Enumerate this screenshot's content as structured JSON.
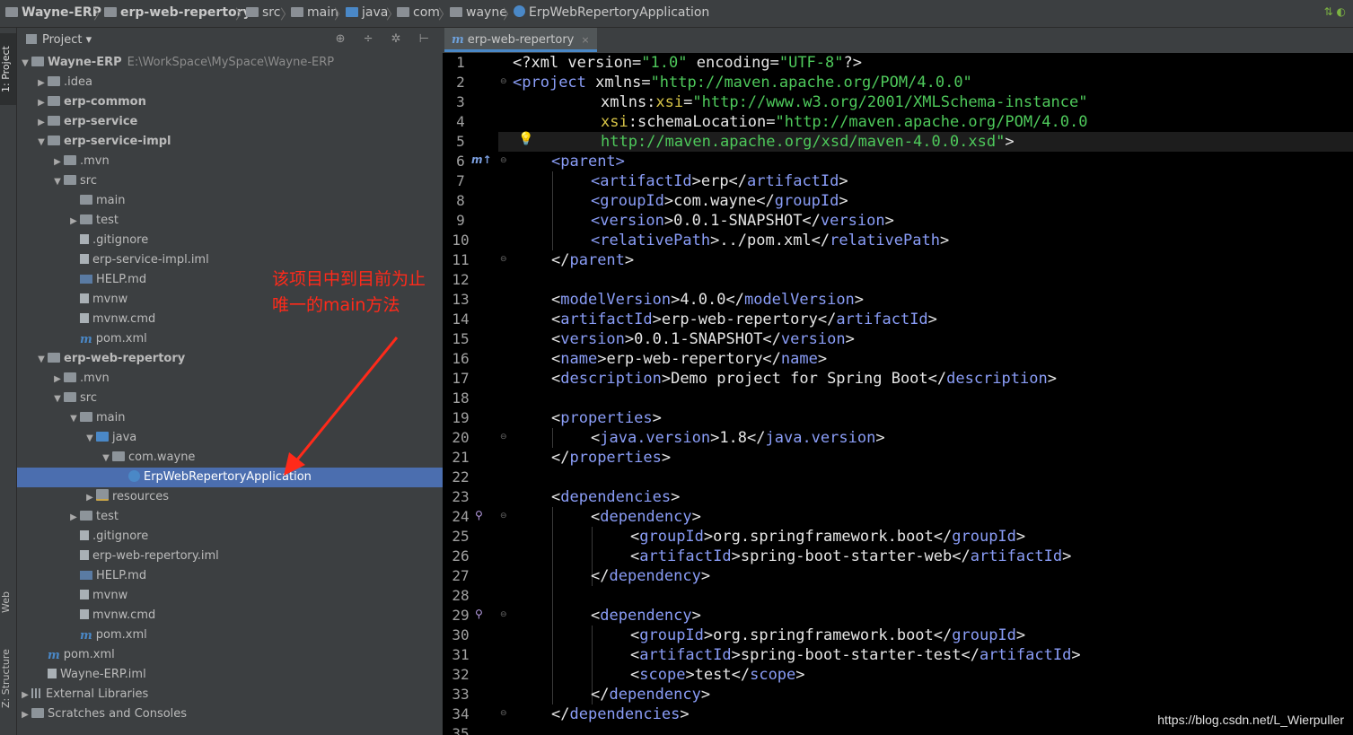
{
  "breadcrumbs": [
    "Wayne-ERP",
    "erp-web-repertory",
    "src",
    "main",
    "java",
    "com",
    "wayne",
    "ErpWebRepertoryApplication"
  ],
  "side_strip": {
    "project": "1: Project",
    "web": "Web",
    "structure": "Z: Structure"
  },
  "project_panel": {
    "title": "Project",
    "dropdown": "▾",
    "tools": "⊕ ÷ ✲ ⊢"
  },
  "tree": [
    {
      "label": "Wayne-ERP",
      "path": "E:\\WorkSpace\\MySpace\\Wayne-ERP"
    },
    {
      "label": ".idea"
    },
    {
      "label": "erp-common"
    },
    {
      "label": "erp-service"
    },
    {
      "label": "erp-service-impl"
    },
    {
      "label": ".mvn"
    },
    {
      "label": "src"
    },
    {
      "label": "main"
    },
    {
      "label": "test"
    },
    {
      "label": ".gitignore"
    },
    {
      "label": "erp-service-impl.iml"
    },
    {
      "label": "HELP.md"
    },
    {
      "label": "mvnw"
    },
    {
      "label": "mvnw.cmd"
    },
    {
      "label": "pom.xml"
    },
    {
      "label": "erp-web-repertory"
    },
    {
      "label": ".mvn"
    },
    {
      "label": "src"
    },
    {
      "label": "main"
    },
    {
      "label": "java"
    },
    {
      "label": "com.wayne"
    },
    {
      "label": "ErpWebRepertoryApplication"
    },
    {
      "label": "resources"
    },
    {
      "label": "test"
    },
    {
      "label": ".gitignore"
    },
    {
      "label": "erp-web-repertory.iml"
    },
    {
      "label": "HELP.md"
    },
    {
      "label": "mvnw"
    },
    {
      "label": "mvnw.cmd"
    },
    {
      "label": "pom.xml"
    },
    {
      "label": "pom.xml"
    },
    {
      "label": "Wayne-ERP.iml"
    },
    {
      "label": "External Libraries"
    },
    {
      "label": "Scratches and Consoles"
    }
  ],
  "annotation": {
    "line1": "该项目中到目前为止",
    "line2": "唯一的main方法"
  },
  "editor_tab": {
    "icon": "m",
    "label": "erp-web-repertory",
    "close": "×"
  },
  "line_numbers": [
    "1",
    "2",
    "3",
    "4",
    "5",
    "6",
    "7",
    "8",
    "9",
    "10",
    "11",
    "12",
    "13",
    "14",
    "15",
    "16",
    "17",
    "18",
    "19",
    "20",
    "21",
    "22",
    "23",
    "24",
    "25",
    "26",
    "27",
    "28",
    "29",
    "30",
    "31",
    "32",
    "33",
    "34",
    "35"
  ],
  "code": {
    "l1": [
      "<?xml version=",
      "\"1.0\"",
      " encoding=",
      "\"UTF-8\"",
      "?>"
    ],
    "l2": [
      "<",
      "project",
      " xmlns=",
      "\"http://maven.apache.org/POM/4.0.0\""
    ],
    "l3": [
      "xmlns:",
      "xsi",
      "=",
      "\"http://www.w3.org/2001/XMLSchema-instance\""
    ],
    "l4": [
      "xsi",
      ":schemaLocation=",
      "\"http://maven.apache.org/POM/4.0.0"
    ],
    "l5": [
      "http://maven.apache.org/xsd/maven-4.0.0.xsd\"",
      ">"
    ],
    "l6": [
      "<",
      "parent",
      ">"
    ],
    "l7": [
      "<",
      "artifactId",
      ">erp</",
      "artifactId",
      ">"
    ],
    "l8": [
      "<",
      "groupId",
      ">com.wayne</",
      "groupId",
      ">"
    ],
    "l9": [
      "<",
      "version",
      ">0.0.1-SNAPSHOT</",
      "version",
      ">"
    ],
    "l10": [
      "<",
      "relativePath",
      ">../pom.xml</",
      "relativePath",
      ">"
    ],
    "l11": [
      "</",
      "parent",
      ">"
    ],
    "l13": [
      "<",
      "modelVersion",
      ">4.0.0</",
      "modelVersion",
      ">"
    ],
    "l14": [
      "<",
      "artifactId",
      ">erp-web-repertory</",
      "artifactId",
      ">"
    ],
    "l15": [
      "<",
      "version",
      ">0.0.1-SNAPSHOT</",
      "version",
      ">"
    ],
    "l16": [
      "<",
      "name",
      ">erp-web-repertory</",
      "name",
      ">"
    ],
    "l17": [
      "<",
      "description",
      ">Demo project for Spring Boot</",
      "description",
      ">"
    ],
    "l19": [
      "<",
      "properties",
      ">"
    ],
    "l20": [
      "<",
      "java.version",
      ">1.8</",
      "java.version",
      ">"
    ],
    "l21": [
      "</",
      "properties",
      ">"
    ],
    "l23": [
      "<",
      "dependencies",
      ">"
    ],
    "l24": [
      "<",
      "dependency",
      ">"
    ],
    "l25": [
      "<",
      "groupId",
      ">org.springframework.boot</",
      "groupId",
      ">"
    ],
    "l26": [
      "<",
      "artifactId",
      ">spring-boot-starter-web</",
      "artifactId",
      ">"
    ],
    "l27": [
      "</",
      "dependency",
      ">"
    ],
    "l29": [
      "<",
      "dependency",
      ">"
    ],
    "l30": [
      "<",
      "groupId",
      ">org.springframework.boot</",
      "groupId",
      ">"
    ],
    "l31": [
      "<",
      "artifactId",
      ">spring-boot-starter-test</",
      "artifactId",
      ">"
    ],
    "l32": [
      "<",
      "scope",
      ">test</",
      "scope",
      ">"
    ],
    "l33": [
      "</",
      "dependency",
      ">"
    ],
    "l34": [
      "</",
      "dependencies",
      ">"
    ]
  },
  "watermark": "https://blog.csdn.net/L_Wierpuller",
  "colors": {
    "tag": "#8a9df7",
    "string": "#4ec95b",
    "namespace": "#d6c347",
    "selection": "#4b6eaf",
    "annotation": "#ff2a1a"
  }
}
